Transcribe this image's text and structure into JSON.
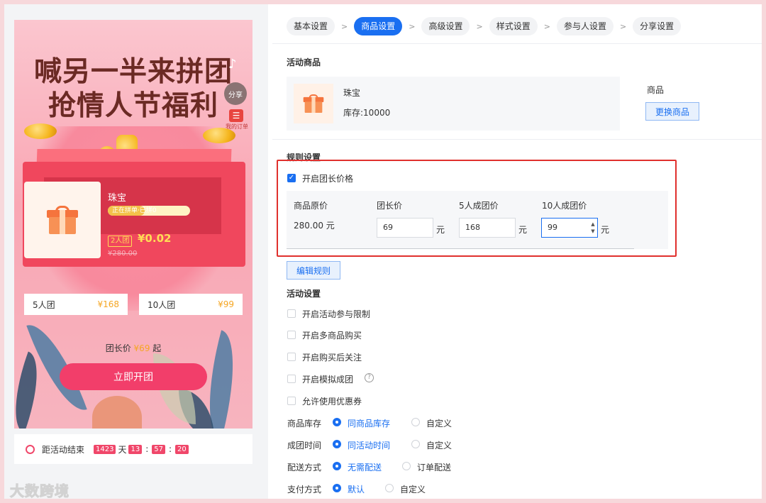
{
  "preview": {
    "title_line1": "喊另一半来拼团",
    "title_line2": "抢情人节福利",
    "share_label": "分享",
    "my_order_label": "我的订单",
    "product_name": "珠宝",
    "progress_text": "正在拼单·已拼0",
    "progress_fraction": 0.45,
    "team_size_tag": "2人团",
    "team_price": "¥0.02",
    "original_price": "¥280.00",
    "tiers": [
      {
        "label": "5人团",
        "price": "¥168"
      },
      {
        "label": "10人团",
        "price": "¥99"
      }
    ],
    "leader_prefix": "团长价",
    "leader_price": "¥69",
    "leader_suffix": "起",
    "start_button": "立即开团",
    "countdown_label": "距活动结束",
    "countdown_days": "1423",
    "countdown_day_unit": "天",
    "countdown_hours": "13",
    "countdown_minutes": "57",
    "countdown_seconds": "20",
    "colon": ":"
  },
  "watermark": "大数跨境",
  "steps": [
    {
      "label": "基本设置",
      "active": false
    },
    {
      "label": "商品设置",
      "active": true
    },
    {
      "label": "高级设置",
      "active": false
    },
    {
      "label": "样式设置",
      "active": false
    },
    {
      "label": "参与人设置",
      "active": false
    },
    {
      "label": "分享设置",
      "active": false
    }
  ],
  "step_separator": ">",
  "goods": {
    "section_title": "活动商品",
    "name": "珠宝",
    "stock": "库存:10000",
    "label": "商品",
    "replace_button": "更换商品"
  },
  "rules": {
    "section_title": "规则设置",
    "leader_price_checkbox": "开启团长价格",
    "leader_price_checked": true,
    "headers": [
      "商品原价",
      "团长价",
      "5人成团价",
      "10人成团价"
    ],
    "original_price": "280.00 元",
    "leader_price_value": "69",
    "five_price_value": "168",
    "ten_price_value": "99",
    "unit": "元",
    "edit_button": "编辑规则"
  },
  "activity": {
    "section_title": "活动设置",
    "checkboxes": [
      {
        "label": "开启活动参与限制",
        "checked": false
      },
      {
        "label": "开启多商品购买",
        "checked": false
      },
      {
        "label": "开启购买后关注",
        "checked": false
      },
      {
        "label": "开启模拟成团",
        "checked": false
      },
      {
        "label": "允许使用优惠券",
        "checked": false
      }
    ],
    "help_icon": "?",
    "radio_groups": [
      {
        "label": "商品库存",
        "options": [
          "同商品库存",
          "自定义"
        ],
        "selected": 0
      },
      {
        "label": "成团时间",
        "options": [
          "同活动时间",
          "自定义"
        ],
        "selected": 0
      },
      {
        "label": "配送方式",
        "options": [
          "无需配送",
          "订单配送"
        ],
        "selected": 0
      },
      {
        "label": "支付方式",
        "options": [
          "默认",
          "自定义"
        ],
        "selected": 0
      }
    ]
  },
  "colors": {
    "accent": "#1a6ff1",
    "highlight_border": "#e0302d",
    "preview_button": "#f23e6a"
  }
}
